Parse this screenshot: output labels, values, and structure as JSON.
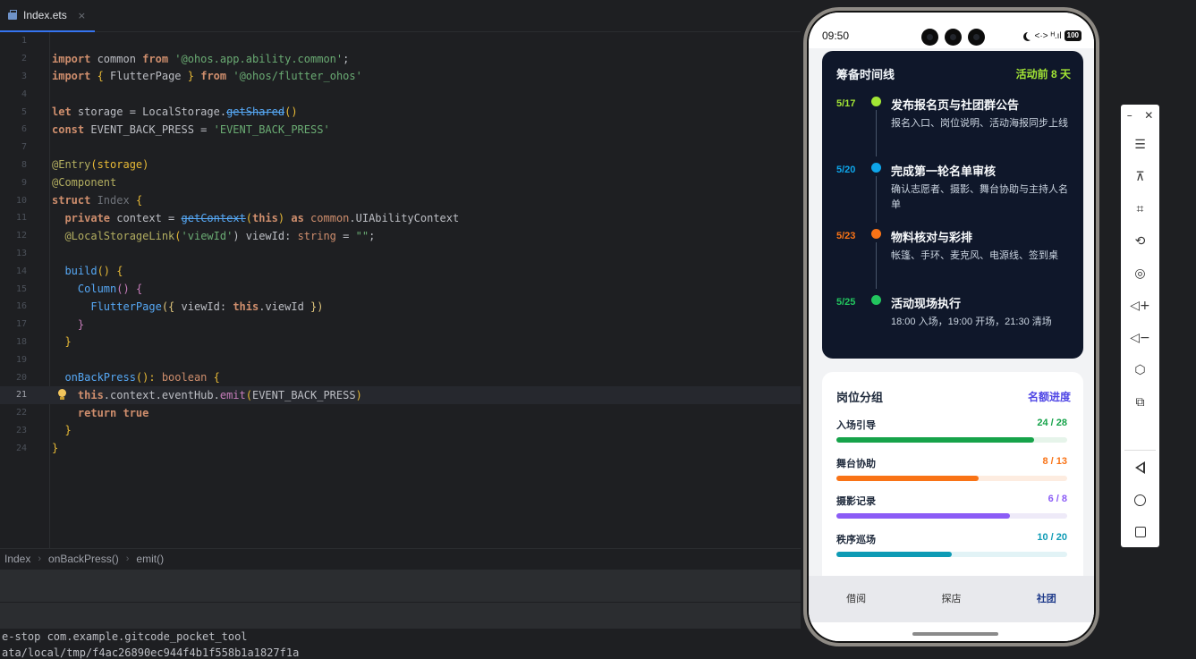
{
  "ide": {
    "tab": {
      "label": "Index.ets",
      "close": "×"
    },
    "code_lines": [
      {
        "n": "1"
      },
      {
        "n": "2"
      },
      {
        "n": "3"
      },
      {
        "n": "4"
      },
      {
        "n": "5"
      },
      {
        "n": "6"
      },
      {
        "n": "7"
      },
      {
        "n": "8"
      },
      {
        "n": "9"
      },
      {
        "n": "10"
      },
      {
        "n": "11"
      },
      {
        "n": "12"
      },
      {
        "n": "13"
      },
      {
        "n": "14"
      },
      {
        "n": "15"
      },
      {
        "n": "16"
      },
      {
        "n": "17"
      },
      {
        "n": "18"
      },
      {
        "n": "19"
      },
      {
        "n": "20"
      },
      {
        "n": "21"
      },
      {
        "n": "22"
      },
      {
        "n": "23"
      },
      {
        "n": "24"
      }
    ],
    "tokens": {
      "l2_import": "import",
      "l2_common": " common ",
      "l2_from": "from",
      "l2_str": " '@ohos.app.ability.common'",
      "l2_semi": ";",
      "l3_import": "import",
      "l3_open": " { ",
      "l3_name": "FlutterPage",
      "l3_close": " } ",
      "l3_from": "from",
      "l3_str": " '@ohos/flutter_ohos'",
      "l5_let": "let",
      "l5_rest": " storage = LocalStorage.",
      "l5_fn": "getShared",
      "l5_paren": "()",
      "l6_const": "const",
      "l6_rest": " EVENT_BACK_PRESS = ",
      "l6_str": "'EVENT_BACK_PRESS'",
      "l8_ann": "@Entry",
      "l8_rest": "(storage)",
      "l9_ann": "@Component",
      "l10_struct": "struct",
      "l10_name": " Index",
      "l10_brace": " {",
      "l11_private": "  private",
      "l11_rest": " context = ",
      "l11_fn": "getContext",
      "l11_open": "(",
      "l11_this": "this",
      "l11_close": ")",
      "l11_as": " as",
      "l11_type": " common",
      "l11_rest2": ".UIAbilityContext",
      "l12_ann": "  @LocalStorageLink",
      "l12_open": "(",
      "l12_str": "'viewId'",
      "l12_rest": ") viewId: ",
      "l12_type": "string",
      "l12_eq": " = ",
      "l12_str2": "\"\"",
      "l12_semi": ";",
      "l14_fn": "  build",
      "l14_rest": "() ",
      "l14_brace": "{",
      "l15_fn": "    Column",
      "l15_rest": "() ",
      "l15_brace": "{",
      "l16_fn": "      FlutterPage",
      "l16_open": "({ ",
      "l16_rest": "viewId: ",
      "l16_this": "this",
      "l16_rest2": ".viewId ",
      "l16_close": "})",
      "l17_brace": "    }",
      "l18_brace": "  }",
      "l20_fn": "  onBackPress",
      "l20_rest": "(): ",
      "l20_type": "boolean",
      "l20_brace": " {",
      "l21_this": "    this",
      "l21_rest": ".context.eventHub.",
      "l21_fn": "emit",
      "l21_open": "(",
      "l21_arg": "EVENT_BACK_PRESS",
      "l21_close": ")",
      "l22_return": "    return",
      "l22_true": " true",
      "l23_brace": "  }",
      "l24_brace": "}"
    },
    "breadcrumb": [
      "Index",
      "onBackPress()",
      "emit()"
    ],
    "breadcrumb_sep": "›",
    "console": [
      "e-stop com.example.gitcode_pocket_tool",
      "ata/local/tmp/f4ac26890ec944f4b1f558b1a1827f1a"
    ]
  },
  "phone": {
    "status": {
      "time": "09:50",
      "network": "<·>",
      "signal": "ᴴ.ıl",
      "battery": "100"
    },
    "timeline": {
      "title": "筹备时间线",
      "badge": "活动前 8 天",
      "items": [
        {
          "date": "5/17",
          "title": "发布报名页与社团群公告",
          "desc": "报名入口、岗位说明、活动海报同步上线",
          "color": "#a3e635"
        },
        {
          "date": "5/20",
          "title": "完成第一轮名单审核",
          "desc": "确认志愿者、摄影、舞台协助与主持人名单",
          "color": "#0ea5e9"
        },
        {
          "date": "5/23",
          "title": "物料核对与彩排",
          "desc": "帐篷、手环、麦克风、电源线、签到桌",
          "color": "#f97316"
        },
        {
          "date": "5/25",
          "title": "活动现场执行",
          "desc": "18:00 入场，19:00 开场，21:30 清场",
          "color": "#22c55e"
        }
      ]
    },
    "roles": {
      "title": "岗位分组",
      "link": "名额进度",
      "items": [
        {
          "name": "入场引导",
          "count": "24 / 28",
          "fraction": 0.857,
          "color": "#16a34a",
          "track": "#e6f4ea"
        },
        {
          "name": "舞台协助",
          "count": "8 / 13",
          "fraction": 0.615,
          "color": "#f97316",
          "track": "#fdece0"
        },
        {
          "name": "摄影记录",
          "count": "6 / 8",
          "fraction": 0.75,
          "color": "#8b5cf6",
          "track": "#eeeaf8"
        },
        {
          "name": "秩序巡场",
          "count": "10 / 20",
          "fraction": 0.5,
          "color": "#0e9bb5",
          "track": "#e2f3f6"
        }
      ]
    },
    "nav": [
      "借阅",
      "探店",
      "社团"
    ]
  },
  "emulator": {
    "top": [
      "–",
      "✕"
    ],
    "buttons": [
      "menu-icon",
      "pin-icon",
      "crop-icon",
      "rotate-icon",
      "screenshot-icon",
      "volume-up-icon",
      "volume-down-icon",
      "shake-icon",
      "multi-device-icon",
      "back-icon",
      "home-icon",
      "recents-icon"
    ],
    "glyphs": {
      "menu": "☰",
      "pin": "⊼",
      "crop": "⌗",
      "rotate": "⟲",
      "screenshot": "◎",
      "volume_up": "◁+",
      "volume_down": "◁−",
      "shake": "⬡",
      "multi": "⧉"
    }
  }
}
